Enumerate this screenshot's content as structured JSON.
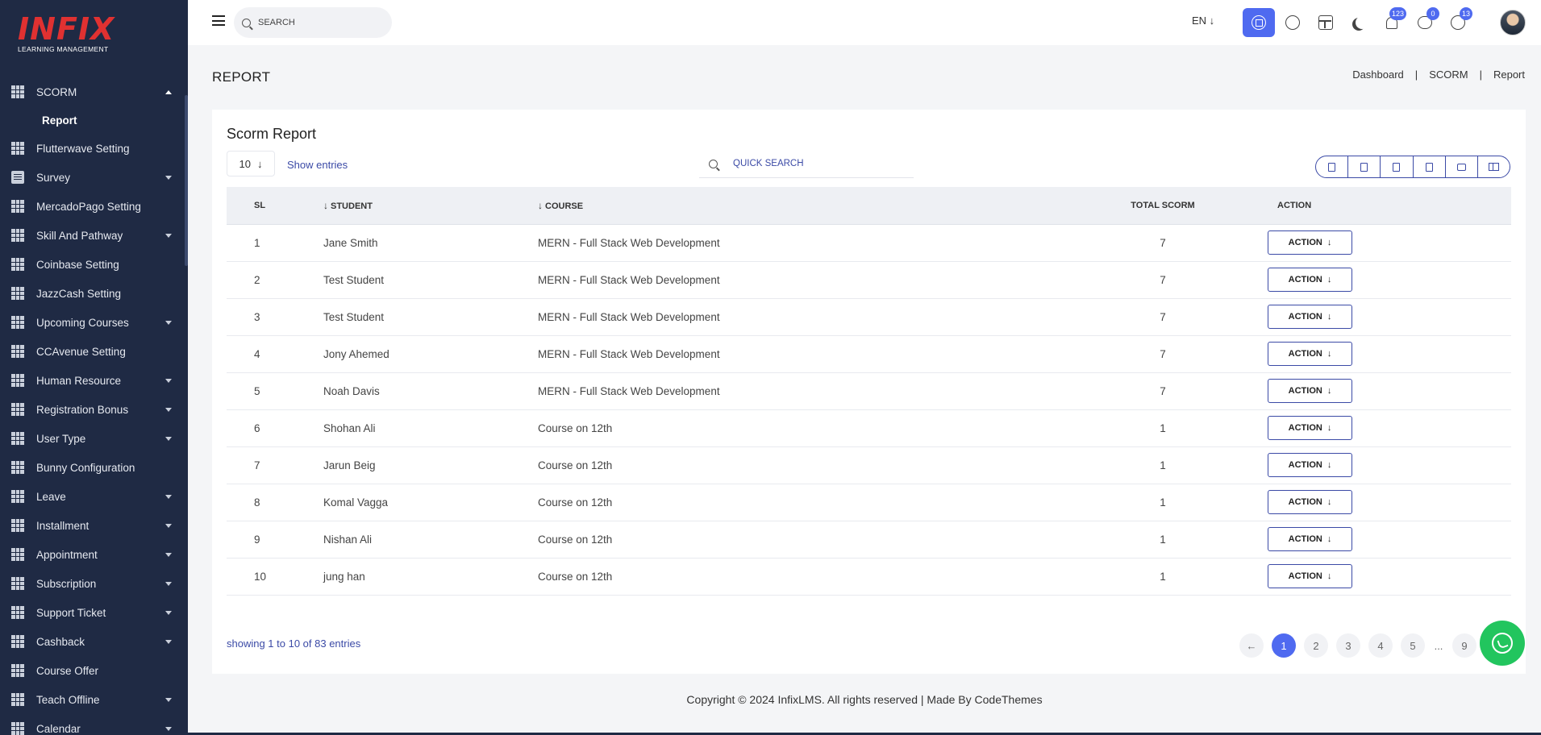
{
  "brand": {
    "logo": "INFIX",
    "subtitle": "LEARNING MANAGEMENT"
  },
  "sidebar": {
    "items": [
      {
        "label": "SCORM",
        "icon": "grid-icon",
        "caret": "up"
      },
      {
        "label": "Flutterwave Setting",
        "icon": "grid-icon",
        "caret": ""
      },
      {
        "label": "Survey",
        "icon": "document-icon",
        "caret": "down"
      },
      {
        "label": "MercadoPago Setting",
        "icon": "grid-icon",
        "caret": ""
      },
      {
        "label": "Skill And Pathway",
        "icon": "grid-icon",
        "caret": "down"
      },
      {
        "label": "Coinbase Setting",
        "icon": "grid-icon",
        "caret": ""
      },
      {
        "label": "JazzCash Setting",
        "icon": "grid-icon",
        "caret": ""
      },
      {
        "label": "Upcoming Courses",
        "icon": "grid-icon",
        "caret": "down"
      },
      {
        "label": "CCAvenue Setting",
        "icon": "grid-icon",
        "caret": ""
      },
      {
        "label": "Human Resource",
        "icon": "grid-icon",
        "caret": "down"
      },
      {
        "label": "Registration Bonus",
        "icon": "grid-icon",
        "caret": "down"
      },
      {
        "label": "User Type",
        "icon": "grid-icon",
        "caret": "down"
      },
      {
        "label": "Bunny Configuration",
        "icon": "grid-icon",
        "caret": ""
      },
      {
        "label": "Leave",
        "icon": "grid-icon",
        "caret": "down"
      },
      {
        "label": "Installment",
        "icon": "grid-icon",
        "caret": "down"
      },
      {
        "label": "Appointment",
        "icon": "grid-icon",
        "caret": "down"
      },
      {
        "label": "Subscription",
        "icon": "grid-icon",
        "caret": "down"
      },
      {
        "label": "Support Ticket",
        "icon": "grid-icon",
        "caret": "down"
      },
      {
        "label": "Cashback",
        "icon": "grid-icon",
        "caret": "down"
      },
      {
        "label": "Course Offer",
        "icon": "grid-icon",
        "caret": ""
      },
      {
        "label": "Teach Offline",
        "icon": "grid-icon",
        "caret": "down"
      },
      {
        "label": "Calendar",
        "icon": "grid-icon",
        "caret": "down"
      }
    ],
    "active_sub_item": "Report"
  },
  "header": {
    "search_placeholder": "SEARCH",
    "language": "EN ↓",
    "notifications_count": "123",
    "messages_count": "0",
    "calls_count": "13"
  },
  "page": {
    "title": "REPORT",
    "breadcrumb": [
      "Dashboard",
      "|",
      "SCORM",
      "|",
      "Report"
    ]
  },
  "report": {
    "title": "Scorm Report",
    "entries_value": "10",
    "entries_label": "Show entries",
    "quick_search_placeholder": "QUICK SEARCH",
    "columns": {
      "sl": "SL",
      "student": "STUDENT",
      "course": "COURSE",
      "total": "TOTAL SCORM",
      "action": "ACTION"
    },
    "action_label": "ACTION",
    "rows": [
      {
        "sl": "1",
        "student": "Jane Smith",
        "course": "MERN - Full Stack Web Development",
        "total": "7"
      },
      {
        "sl": "2",
        "student": "Test Student",
        "course": "MERN - Full Stack Web Development",
        "total": "7"
      },
      {
        "sl": "3",
        "student": "Test Student",
        "course": "MERN - Full Stack Web Development",
        "total": "7"
      },
      {
        "sl": "4",
        "student": "Jony Ahemed",
        "course": "MERN - Full Stack Web Development",
        "total": "7"
      },
      {
        "sl": "5",
        "student": "Noah Davis",
        "course": "MERN - Full Stack Web Development",
        "total": "7"
      },
      {
        "sl": "6",
        "student": "Shohan Ali",
        "course": "Course on 12th",
        "total": "1"
      },
      {
        "sl": "7",
        "student": "Jarun Beig",
        "course": "Course on 12th",
        "total": "1"
      },
      {
        "sl": "8",
        "student": "Komal Vagga",
        "course": "Course on 12th",
        "total": "1"
      },
      {
        "sl": "9",
        "student": "Nishan Ali",
        "course": "Course on 12th",
        "total": "1"
      },
      {
        "sl": "10",
        "student": "jung han",
        "course": "Course on 12th",
        "total": "1"
      }
    ],
    "showing_text": "showing 1 to 10 of 83 entries",
    "pagination": [
      "←",
      "1",
      "2",
      "3",
      "4",
      "5",
      "...",
      "9"
    ],
    "current_page": "1"
  },
  "footer": {
    "copyright": "Copyright © 2024 InfixLMS. All rights reserved | Made By CodeThemes"
  },
  "colors": {
    "sidebar_bg": "#1f2a44",
    "accent": "#4f6af0",
    "link": "#3b4aa6",
    "whatsapp": "#22c55e"
  }
}
